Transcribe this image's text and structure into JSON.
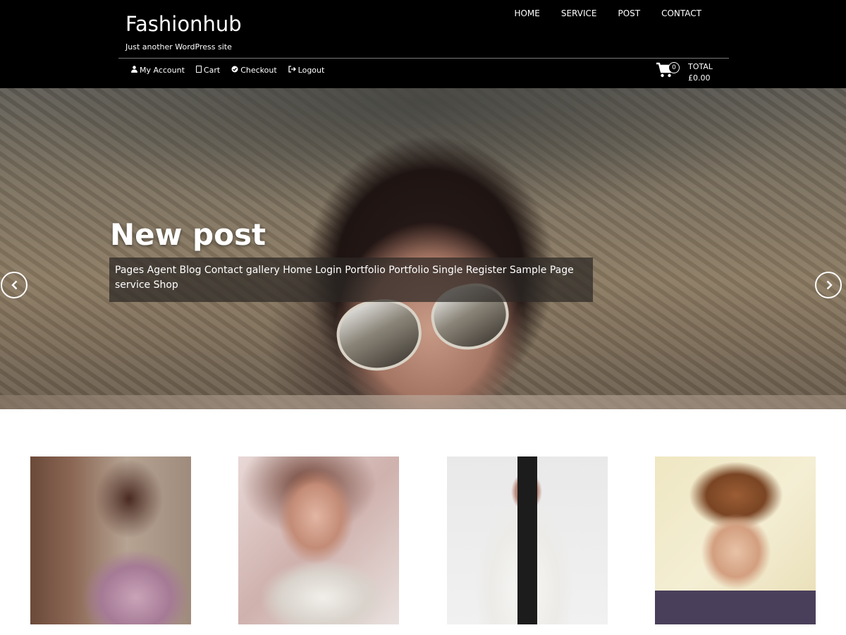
{
  "site": {
    "title": "Fashionhub",
    "tagline": "Just another WordPress site"
  },
  "main_nav": [
    "HOME",
    "SERVICE",
    "POST",
    "CONTACT"
  ],
  "account_links": [
    {
      "label": "My Account",
      "icon": "user-icon"
    },
    {
      "label": "Cart",
      "icon": "cart-outline-icon"
    },
    {
      "label": "Checkout",
      "icon": "check-circle-icon"
    },
    {
      "label": "Logout",
      "icon": "logout-icon"
    }
  ],
  "cart": {
    "count": "0",
    "total_label": "TOTAL",
    "total_value": "£0.00"
  },
  "hero": {
    "title": "New post",
    "caption": "Pages Agent Blog Contact gallery Home Login Portfolio Portfolio Single Register Sample Page service Shop"
  },
  "products": [
    {
      "image": "woman-pink-dress-photo"
    },
    {
      "image": "woman-white-top-photo"
    },
    {
      "image": "woman-white-jacket-photo"
    },
    {
      "image": "woman-retro-hairstyle-photo"
    }
  ],
  "colors": {
    "header_bg": "#000000",
    "text": "#ffffff"
  }
}
